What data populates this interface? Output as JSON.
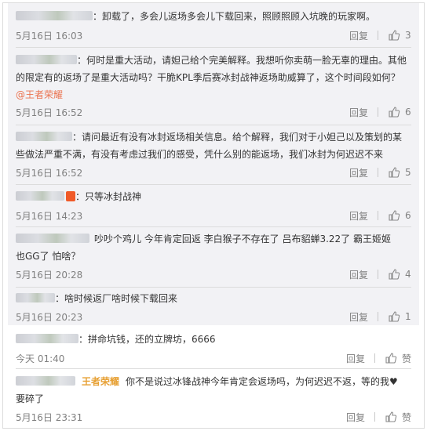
{
  "comments": [
    {
      "text": "：卸载了，多会儿返场多会儿下载回来，照顾照顾入坑晚的玩家啊。",
      "time": "5月16日 16:03",
      "reply": "回复",
      "likes": "3"
    },
    {
      "text_line1": "：何时是重大活动，请妲己给个完美解释。我想听你卖萌一脸无辜的理由。其他",
      "text_line2": "的限定有的返场了是重大活动吗？干脆KPL季后赛冰封战神返场助威算了，这个时间段如何？",
      "mention": "@王者荣耀",
      "time": "5月16日 16:52",
      "reply": "回复",
      "likes": "6"
    },
    {
      "text_line1": "：请问最近有没有冰封返场相关信息。给个解释，我们对于小妲己以及策划的某",
      "text_line2": "些做法严重不满，有没有考虑过我们的感受，凭什么别的能返场，我们冰封为何迟迟不来",
      "time": "5月16日 16:52",
      "reply": "回复",
      "likes": "5"
    },
    {
      "text": "：只等冰封战神",
      "time": "5月16日 14:23",
      "reply": "回复",
      "likes": "6"
    },
    {
      "text_line1": "吵吵个鸡儿  今年肯定回返  李白猴子不存在了  吕布貂蝉3.22了  霸王姬姬",
      "text_line2": "也GG了  怕啥？",
      "time": "5月16日 20:28",
      "reply": "回复",
      "likes": "4"
    },
    {
      "text": "：啥时候返厂啥时候下载回来",
      "time": "5月16日 20:23",
      "reply": "回复",
      "likes": "1"
    }
  ],
  "outer_comments": [
    {
      "text": "：拼命坑钱，还的立牌坊，6666",
      "time": "今天 01:40",
      "reply": "回复",
      "like_label": "赞"
    },
    {
      "author": "王者荣耀",
      "text_line1": "你不是说过冰锋战神今年肯定会返场吗，为何迟迟不返，等的我♥",
      "text_line2": "要碎了",
      "time": "5月16日 23:31",
      "reply": "回复",
      "like_label": "赞"
    }
  ],
  "icons": {
    "like": "thumbs-up-icon",
    "badge": "vip-badge-icon"
  },
  "colors": {
    "inner_bg": "#f2f2f5",
    "mention": "#eb7350",
    "vip_name": "#e7a136",
    "meta_text": "#808080"
  }
}
